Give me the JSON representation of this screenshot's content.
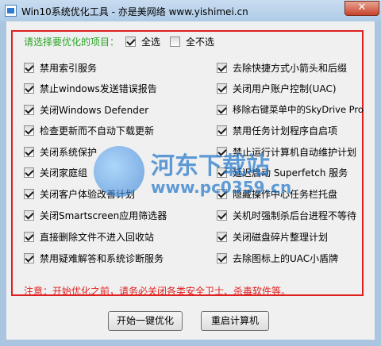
{
  "window": {
    "title": "Win10系统优化工具 - 亦是美网络 www.yishimei.cn",
    "close_label": "✕"
  },
  "header": {
    "prompt": "请选择要优化的项目：",
    "select_all": {
      "label": "全选",
      "checked": true
    },
    "select_none": {
      "label": "全不选",
      "checked": false
    }
  },
  "options_left": [
    {
      "label": "禁用索引服务",
      "checked": true
    },
    {
      "label": "禁止windows发送错误报告",
      "checked": true
    },
    {
      "label": "关闭Windows Defender",
      "checked": true
    },
    {
      "label": "检查更新而不自动下载更新",
      "checked": true
    },
    {
      "label": "关闭系统保护",
      "checked": true
    },
    {
      "label": "关闭家庭组",
      "checked": true
    },
    {
      "label": "关闭客户体验改善计划",
      "checked": true
    },
    {
      "label": "关闭Smartscreen应用筛选器",
      "checked": true
    },
    {
      "label": "直接删除文件不进入回收站",
      "checked": true
    },
    {
      "label": "禁用疑难解答和系统诊断服务",
      "checked": true
    }
  ],
  "options_right": [
    {
      "label": "去除快捷方式小箭头和后缀",
      "checked": true
    },
    {
      "label": "关闭用户账户控制(UAC)",
      "checked": true
    },
    {
      "label": "移除右键菜单中的SkyDrive Pro",
      "checked": true
    },
    {
      "label": "禁用任务计划程序自启项",
      "checked": true
    },
    {
      "label": "禁止运行计算机自动维护计划",
      "checked": true
    },
    {
      "label": "延迟启动 Superfetch 服务",
      "checked": true
    },
    {
      "label": "隐藏操作中心任务栏托盘",
      "checked": true
    },
    {
      "label": "关机时强制杀后台进程不等待",
      "checked": true
    },
    {
      "label": "关闭磁盘碎片整理计划",
      "checked": true
    },
    {
      "label": "去除图标上的UAC小盾牌",
      "checked": true
    }
  ],
  "note": "注意：开始优化之前，请务必关闭各类安全卫士、杀毒软件等。",
  "buttons": {
    "optimize": "开始一键优化",
    "restart": "重启计算机"
  },
  "watermark": {
    "text": "河东下载站",
    "url": "www.pc0359.cn"
  },
  "colors": {
    "panel_border": "#e02020",
    "prompt_text": "#26a626",
    "note_text": "#e02020",
    "watermark": "#1a72c9"
  }
}
